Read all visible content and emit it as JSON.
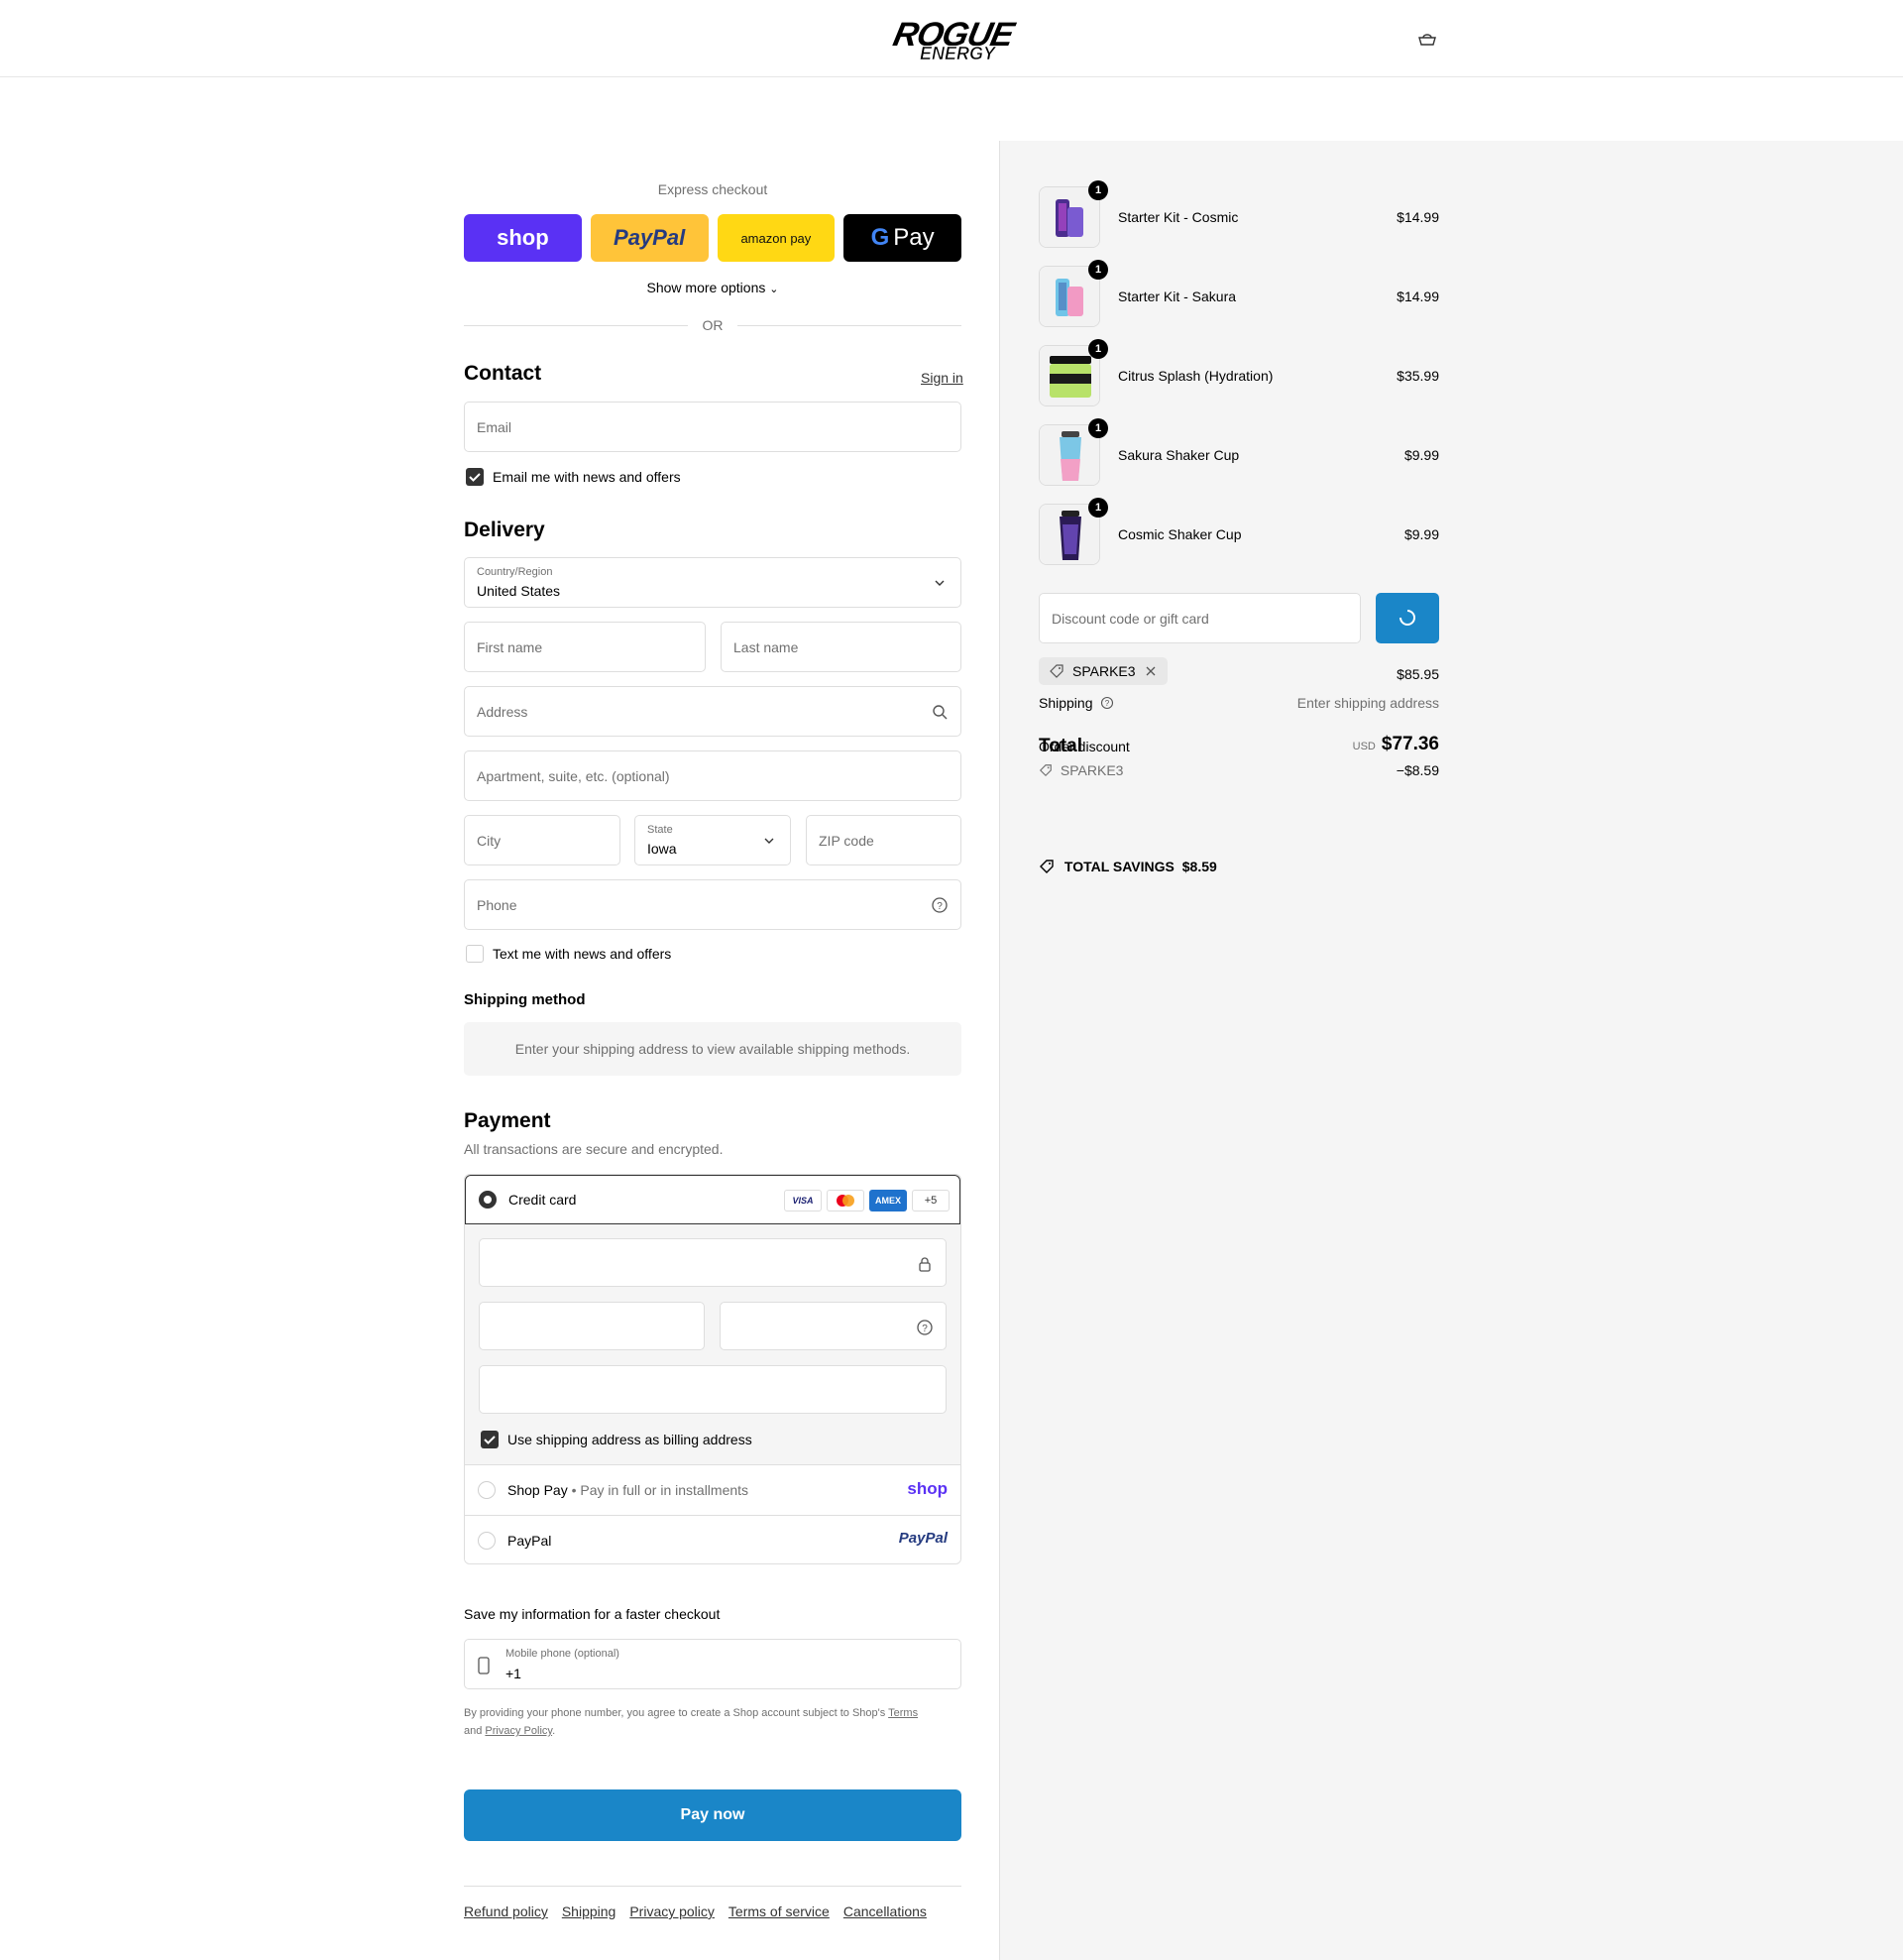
{
  "brand": {
    "logo_line1": "ROGUE",
    "logo_line2": "ENERGY"
  },
  "express": {
    "title": "Express checkout",
    "shop_label": "shop",
    "paypal_label": "PayPal",
    "amazon_label": "amazon pay",
    "gpay_label": "Pay",
    "more_options": "Show more options",
    "or": "OR"
  },
  "contact": {
    "heading": "Contact",
    "sign_in": "Sign in",
    "email_placeholder": "Email",
    "email_opt_in": "Email me with news and offers"
  },
  "delivery": {
    "heading": "Delivery",
    "country_label": "Country/Region",
    "country_value": "United States",
    "first_name": "First name",
    "last_name": "Last name",
    "address": "Address",
    "apartment": "Apartment, suite, etc. (optional)",
    "city": "City",
    "state_label": "State",
    "state_value": "Iowa",
    "zip": "ZIP code",
    "phone": "Phone",
    "text_opt_in": "Text me with news and offers"
  },
  "shipping_method": {
    "heading": "Shipping method",
    "notice": "Enter your shipping address to view available shipping methods."
  },
  "payment": {
    "heading": "Payment",
    "subtitle": "All transactions are secure and encrypted.",
    "credit_card": "Credit card",
    "brands": [
      "VISA",
      "",
      "AMEX",
      "+5"
    ],
    "billing_same": "Use shipping address as billing address",
    "shop_pay": "Shop Pay",
    "shop_pay_sub": "Pay in full or in installments",
    "shop_pay_logo": "shop",
    "paypal": "PayPal",
    "paypal_logo": "PayPal"
  },
  "save_info": {
    "heading": "Save my information for a faster checkout",
    "mobile_label": "Mobile phone (optional)",
    "mobile_value": "+1",
    "disclaimer_1": "By providing your phone number, you agree to create a Shop account subject to Shop's",
    "terms": "Terms",
    "and": "and",
    "privacy": "Privacy Policy",
    "period": "."
  },
  "pay_now": "Pay now",
  "footer": [
    "Refund policy",
    "Shipping",
    "Privacy policy",
    "Terms of service",
    "Cancellations"
  ],
  "summary": {
    "items": [
      {
        "name": "Starter Kit - Cosmic",
        "price": "$14.99",
        "qty": "1"
      },
      {
        "name": "Starter Kit - Sakura",
        "price": "$14.99",
        "qty": "1"
      },
      {
        "name": "Citrus Splash (Hydration)",
        "price": "$35.99",
        "qty": "1"
      },
      {
        "name": "Sakura Shaker Cup",
        "price": "$9.99",
        "qty": "1"
      },
      {
        "name": "Cosmic Shaker Cup",
        "price": "$9.99",
        "qty": "1"
      }
    ],
    "discount_placeholder": "Discount code or gift card",
    "applied_code": "SPARKE3",
    "subtotal": "$85.95",
    "shipping_label": "Shipping",
    "shipping_value": "Enter shipping address",
    "total_label": "Total",
    "order_discount_label": "Order discount",
    "currency": "USD",
    "total": "$77.36",
    "discount_code": "SPARKE3",
    "discount_amount": "−$8.59",
    "savings_label": "TOTAL SAVINGS",
    "savings_value": "$8.59"
  },
  "colors": {
    "accent": "#1a86c8",
    "shop_purple": "#5a31f4",
    "paypal_yellow": "#ffc439",
    "amazon_yellow": "#ffd814"
  }
}
